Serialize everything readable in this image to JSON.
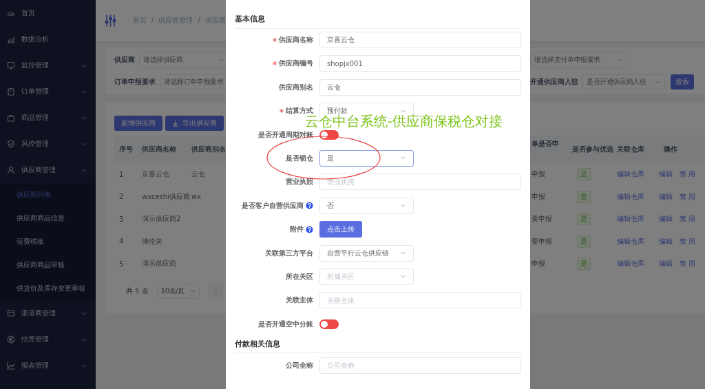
{
  "sidebar": {
    "items": [
      {
        "label": "首页"
      },
      {
        "label": "数据分析"
      },
      {
        "label": "监控管理",
        "expanded": false
      },
      {
        "label": "订单管理",
        "expanded": false
      },
      {
        "label": "商品管理",
        "expanded": false
      },
      {
        "label": "风控管理",
        "expanded": false
      },
      {
        "label": "供应商管理",
        "expanded": true,
        "children": [
          {
            "label": "供应商列表",
            "selected": true
          },
          {
            "label": "供应商商品信息",
            "selected": false
          },
          {
            "label": "运费模板",
            "selected": false
          },
          {
            "label": "供应商商品审核",
            "selected": false
          },
          {
            "label": "供货价及库存变更审核",
            "selected": false
          }
        ]
      },
      {
        "label": "渠道商管理",
        "expanded": false
      },
      {
        "label": "结算管理",
        "expanded": false
      },
      {
        "label": "报表管理",
        "expanded": false
      }
    ]
  },
  "breadcrumb": [
    "首页",
    "/",
    "供应商管理",
    "/",
    "供应商"
  ],
  "filters": {
    "left": [
      {
        "label": "供应商",
        "placeholder": "请选择供应商"
      },
      {
        "label": "订单申报要求",
        "placeholder": "请选择订单申报要求"
      }
    ],
    "right": [
      {
        "placeholder": "请选择支付单申报要求"
      },
      {
        "label": "开通供应商入驻",
        "placeholder": "是否开通供应商入驻"
      }
    ],
    "search_button": "搜索"
  },
  "toolbar": [
    {
      "label": "新增供应商",
      "kind": "plain"
    },
    {
      "label": "导出供应商",
      "kind": "download"
    }
  ],
  "table": {
    "columns": [
      "序号",
      "供应商名称",
      "供应商别名",
      "单是否申",
      "是否参与优选",
      "关联仓库",
      "操作"
    ],
    "rows": [
      {
        "no": "1",
        "name": "京喜云仓",
        "alias": "云仓",
        "column_4": "申报",
        "preferred": "是",
        "warehouse": "编辑仓库",
        "actions": [
          "编辑",
          "禁 用"
        ]
      },
      {
        "no": "2",
        "name": "wxceshi供应商",
        "alias": "wx",
        "column_4": "申报",
        "preferred": "是",
        "warehouse": "编辑仓库",
        "actions": [
          "编辑",
          "禁 用"
        ]
      },
      {
        "no": "3",
        "name": "演示供应商2",
        "column_4": "要申报",
        "preferred": "是",
        "warehouse": "编辑仓库",
        "actions": [
          "编辑",
          "禁 用"
        ]
      },
      {
        "no": "4",
        "name": "博伦美",
        "column_4": "要申报",
        "preferred": "是",
        "warehouse": "编辑仓库",
        "actions": [
          "编辑",
          "禁 用"
        ]
      },
      {
        "no": "5",
        "name": "演示供应商",
        "column_4": "申报",
        "preferred": "是",
        "warehouse": "编辑仓库",
        "actions": [
          "编辑",
          "禁 用"
        ]
      }
    ]
  },
  "pagination": {
    "total": "共 5 条",
    "page_size": "10条/页"
  },
  "modal": {
    "sections": [
      {
        "title": "基本信息",
        "fields": [
          {
            "kind": "input",
            "label": "供应商名称",
            "required": true,
            "value": "京喜云仓"
          },
          {
            "kind": "input",
            "label": "供应商编号",
            "required": true,
            "value": "shopjx001"
          },
          {
            "kind": "input",
            "label": "供应商别名",
            "required": false,
            "value": "云仓"
          },
          {
            "kind": "select",
            "label": "结算方式",
            "required": true,
            "value": "预付款",
            "focused": false
          },
          {
            "kind": "switch",
            "label": "是否开通周期对账",
            "required": false,
            "on": false
          },
          {
            "kind": "select",
            "label": "是否锁仓",
            "required": false,
            "value": "是",
            "focused": true
          },
          {
            "kind": "input",
            "label": "营业执照",
            "required": false,
            "placeholder": "营业执照"
          },
          {
            "kind": "select",
            "label": "是否客户自营供应商",
            "required": false,
            "help": true,
            "value": "否",
            "focused": false
          },
          {
            "kind": "upload",
            "label": "附件",
            "required": false,
            "help": true,
            "button": "点击上传"
          },
          {
            "kind": "select",
            "label": "关联第三方平台",
            "required": false,
            "value": "自营平行云仓供应链",
            "focused": false
          },
          {
            "kind": "select",
            "label": "所在关区",
            "required": false,
            "placeholder": "所属关区",
            "focused": false
          },
          {
            "kind": "input",
            "label": "关联主体",
            "required": false,
            "placeholder": "关联主体"
          },
          {
            "kind": "switch",
            "label": "是否开通空中分账",
            "required": false,
            "on": false
          }
        ]
      },
      {
        "title": "付款相关信息",
        "fields": [
          {
            "kind": "input",
            "label": "公司全称",
            "required": false,
            "placeholder": "公司全称"
          }
        ]
      }
    ]
  },
  "annotation": {
    "caption": "云仓中台系统-供应商保税仓对接"
  }
}
